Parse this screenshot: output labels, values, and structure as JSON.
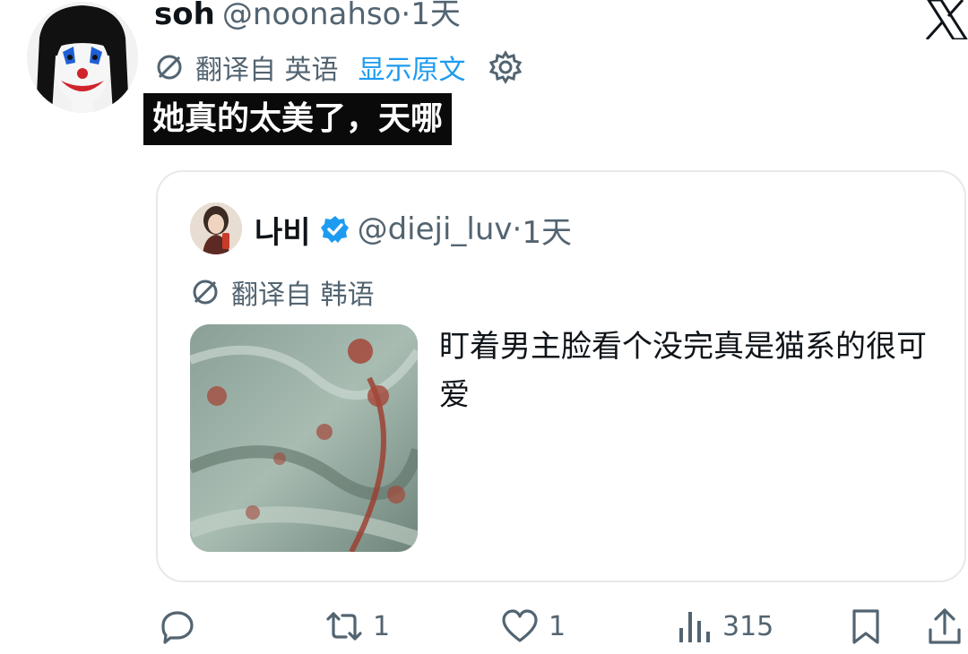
{
  "tweet": {
    "author_name": "soh",
    "author_handle": "@noonahso",
    "separator": "·",
    "time": "1天",
    "translate_label": "翻译自 英语",
    "show_original": "显示原文",
    "text": "她真的太美了，天哪"
  },
  "quote": {
    "author_name": "나비",
    "author_handle": "@dieji_luv",
    "separator": "·",
    "time": "1天",
    "translate_label": "翻译自 韩语",
    "text": "盯着男主脸看个没完真是猫系的很可爱"
  },
  "actions": {
    "reply_count": "",
    "retweet_count": "1",
    "like_count": "1",
    "views_count": "315"
  },
  "icons": {
    "logo": "x-logo-icon",
    "translate": "translate-icon",
    "settings": "gear-icon",
    "verified": "verified-badge-icon",
    "reply": "reply-icon",
    "retweet": "retweet-icon",
    "like": "heart-icon",
    "views": "views-chart-icon",
    "bookmark": "bookmark-icon",
    "share": "share-icon"
  },
  "colors": {
    "accent": "#1d9bf0",
    "muted": "#536471",
    "text": "#0f1419",
    "highlight_bg": "#0a0a0a"
  }
}
